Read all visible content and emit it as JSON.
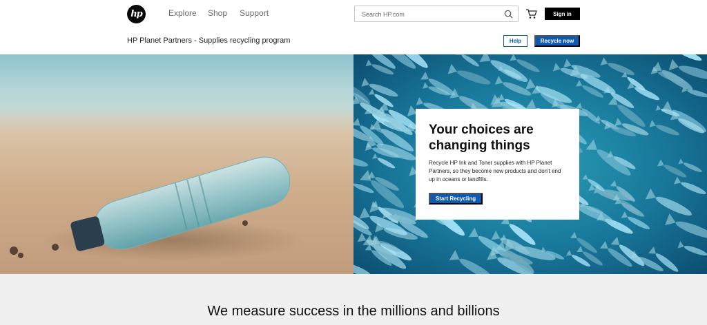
{
  "nav": {
    "logo_text": "hp",
    "links": [
      "Explore",
      "Shop",
      "Support"
    ],
    "search_placeholder": "Search HP.com",
    "signin_label": "Sign in"
  },
  "subnav": {
    "title": "HP Planet Partners - Supplies recycling program",
    "help_label": "Help",
    "recycle_label": "Recycle now"
  },
  "hero": {
    "title": "Your choices are changing things",
    "text": "Recycle HP Ink and Toner supplies with HP Planet Partners, so they become new products and don't end up in oceans or landfills.",
    "button_label": "Start Recycling"
  },
  "section": {
    "heading": "We measure success in the millions and billions"
  },
  "colors": {
    "accent": "#0f5bb3",
    "signin_bg": "#000000"
  },
  "icons": [
    "hp-logo-icon",
    "search-icon",
    "cart-icon"
  ]
}
